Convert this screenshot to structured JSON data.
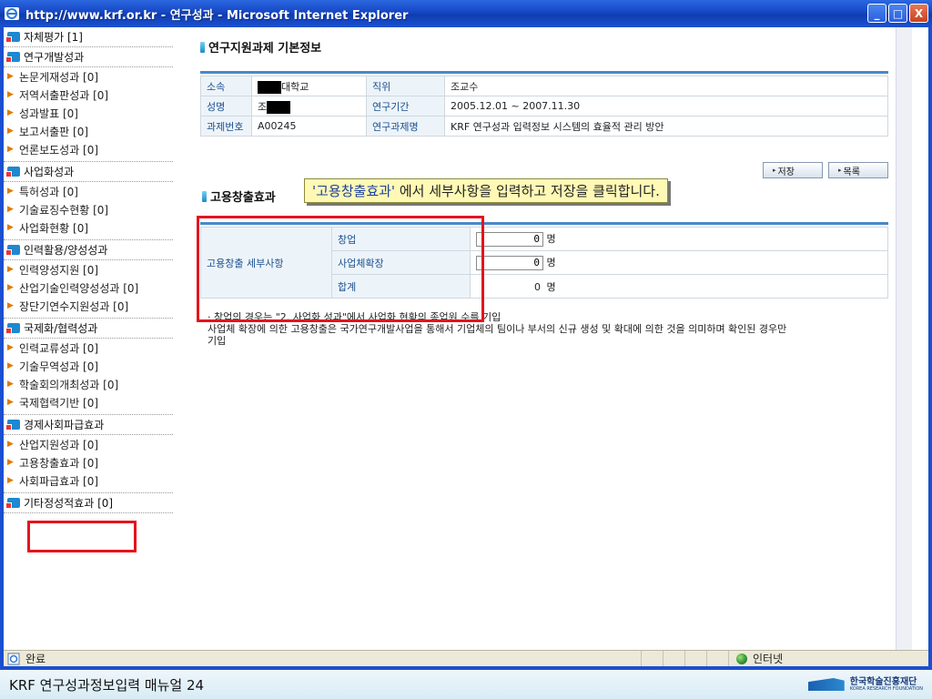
{
  "window": {
    "title": "http://www.krf.or.kr - 연구성과 - Microsoft Internet Explorer",
    "min_symbol": "_",
    "max_symbol": "□",
    "close_symbol": "X"
  },
  "sidebar": {
    "top_item": {
      "label": "자체평가 [1]",
      "icon": "plus-folder-icon"
    },
    "sections": [
      {
        "label": "연구개발성과",
        "icon": "plus-folder-icon",
        "items": [
          "논문게재성과 [0]",
          "저역서출판성과 [0]",
          "성과발표 [0]",
          "보고서출판 [0]",
          "언론보도성과 [0]"
        ]
      },
      {
        "label": "사업화성과",
        "icon": "plus-folder-icon",
        "items": [
          "특허성과 [0]",
          "기술료징수현황 [0]",
          "사업화현황 [0]"
        ]
      },
      {
        "label": "인력활용/양성성과",
        "icon": "plus-folder-icon",
        "items": [
          "인력양성지원 [0]",
          "산업기술인력양성성과 [0]",
          "장단기연수지원성과 [0]"
        ]
      },
      {
        "label": "국제화/협력성과",
        "icon": "plus-folder-icon",
        "items": [
          "인력교류성과 [0]",
          "기술무역성과 [0]",
          "학술회의개최성과 [0]",
          "국제협력기반 [0]"
        ]
      },
      {
        "label": "경제사회파급효과",
        "icon": "plus-folder-icon",
        "items": [
          "산업지원성과 [0]",
          "고용창출효과 [0]",
          "사회파급효과 [0]"
        ]
      },
      {
        "label": "기타정성적효과 [0]",
        "icon": "plus-folder-icon",
        "items": []
      }
    ],
    "arrow_glyph": "▶"
  },
  "basic_info": {
    "title": "연구지원과제 기본정보",
    "rows": [
      {
        "l1": "소속",
        "v1": "대학교",
        "l2": "직위",
        "v2": "조교수"
      },
      {
        "l1": "성명",
        "v1": "조",
        "l2": "연구기간",
        "v2": "2005.12.01 ~ 2007.11.30"
      },
      {
        "l1": "과제번호",
        "v1": "A00245",
        "l2": "연구과제명",
        "v2": "KRF 연구성과 입력정보 시스템의 효율적 관리 방안"
      }
    ]
  },
  "buttons": {
    "save": "저장",
    "list": "목록",
    "tri": "▸"
  },
  "employment": {
    "title": "고용창출효과",
    "row_header": "고용창출 세부사항",
    "rows": [
      {
        "label": "창업",
        "value": "0",
        "unit": "명"
      },
      {
        "label": "사업체확장",
        "value": "0",
        "unit": "명"
      },
      {
        "label": "합계",
        "value": "0",
        "unit": "명"
      }
    ],
    "note1": "· 창업의 경우는 \"2. 사업화 성과\"에서 사업화 현황의 종업원 수를 기입",
    "note2": "  사업체 확장에 의한 고용창출은 국가연구개발사업을 통해서 기업체의 팀이나 부서의 신규 생성 및 확대에 의한 것을 의미하며 확인된 경우만",
    "note3": "  기입"
  },
  "callout": {
    "highlight": "'고용창출효과'",
    "text": " 에서 세부사항을 입력하고 저장을 클릭합니다."
  },
  "statusbar": {
    "done": "완료",
    "zone": "인터넷"
  },
  "footer": {
    "manual": "KRF 연구성과정보입력 매뉴얼 24",
    "logo_ko": "한국학술진흥재단",
    "logo_en": "KOREA RESEARCH FOUNDATION"
  }
}
